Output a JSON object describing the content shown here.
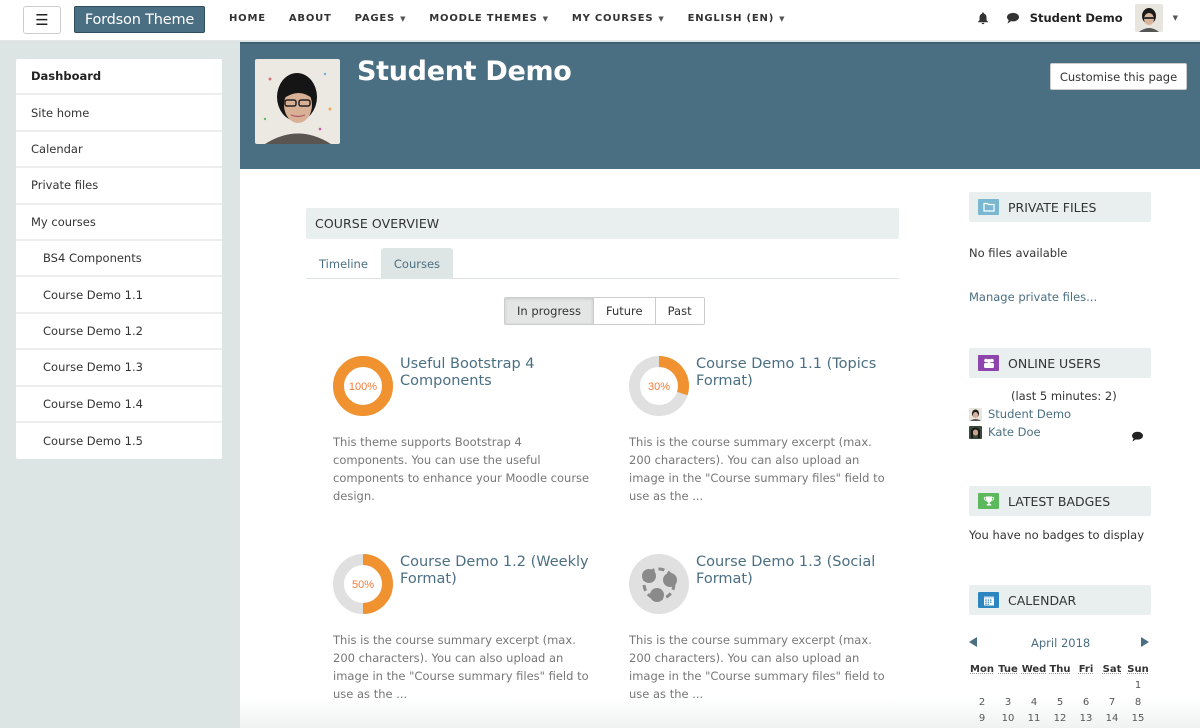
{
  "navbar": {
    "menu_icon": "hamburger-icon",
    "brand": "Fordson Theme",
    "links": [
      {
        "label": "HOME",
        "dropdown": false
      },
      {
        "label": "ABOUT",
        "dropdown": false
      },
      {
        "label": "PAGES",
        "dropdown": true
      },
      {
        "label": "MOODLE THEMES",
        "dropdown": true
      },
      {
        "label": "MY COURSES",
        "dropdown": true
      },
      {
        "label": "ENGLISH (EN)",
        "dropdown": true
      }
    ],
    "notification_icon": "bell-icon",
    "message_icon": "chat-bubble-icon",
    "user_name": "Student Demo",
    "caret": "▾"
  },
  "sidebar": {
    "items": [
      {
        "label": "Dashboard"
      },
      {
        "label": "Site home"
      },
      {
        "label": "Calendar"
      },
      {
        "label": "Private files"
      },
      {
        "label": "My courses"
      },
      {
        "label": "BS4 Components"
      },
      {
        "label": "Course Demo 1.1"
      },
      {
        "label": "Course Demo 1.2"
      },
      {
        "label": "Course Demo 1.3"
      },
      {
        "label": "Course Demo 1.4"
      },
      {
        "label": "Course Demo 1.5"
      }
    ]
  },
  "header": {
    "title": "Student Demo",
    "customise_button": "Customise this page"
  },
  "course_overview": {
    "title": "COURSE OVERVIEW",
    "tabs": [
      {
        "label": "Timeline",
        "active": false
      },
      {
        "label": "Courses",
        "active": true
      }
    ],
    "filters": [
      {
        "label": "In progress",
        "active": true
      },
      {
        "label": "Future",
        "active": false
      },
      {
        "label": "Past",
        "active": false
      }
    ],
    "courses": [
      {
        "title": "Useful Bootstrap 4 Components",
        "progress": 100,
        "progress_label": "100%",
        "summary": "This theme supports Bootstrap 4 components. You can use the useful components to enhance your Moodle course design."
      },
      {
        "title": "Course Demo 1.1 (Topics Format)",
        "progress": 30,
        "progress_label": "30%",
        "summary": "This is the course summary excerpt (max. 200 characters). You can also upload an image in the \"Course summary files\" field to use as the ..."
      },
      {
        "title": "Course Demo 1.2 (Weekly Format)",
        "progress": 50,
        "progress_label": "50%",
        "summary": "This is the course summary excerpt (max. 200 characters). You can also upload an image in the \"Course summary files\" field to use as the ..."
      },
      {
        "title": "Course Demo 1.3 (Social Format)",
        "progress": null,
        "progress_label": "",
        "icon": "social-course-icon",
        "summary": "This is the course summary excerpt (max. 200 characters). You can also upload an image in the \"Course summary files\" field to use as the ..."
      }
    ]
  },
  "blocks": {
    "private_files": {
      "title": "PRIVATE FILES",
      "icon": "folder-icon",
      "empty_text": "No files available",
      "manage_link": "Manage private files..."
    },
    "online_users": {
      "title": "ONLINE USERS",
      "icon": "users-icon",
      "subtitle": "(last 5 minutes: 2)",
      "users": [
        {
          "name": "Student Demo"
        },
        {
          "name": "Kate Doe"
        }
      ]
    },
    "latest_badges": {
      "title": "LATEST BADGES",
      "icon": "trophy-icon",
      "empty_text": "You have no badges to display"
    },
    "calendar": {
      "title": "CALENDAR",
      "icon": "calendar-icon",
      "month": "April 2018",
      "weekdays": [
        "Mon",
        "Tue",
        "Wed",
        "Thu",
        "Fri",
        "Sat",
        "Sun"
      ],
      "weeks": [
        [
          "",
          "",
          "",
          "",
          "",
          "",
          "1"
        ],
        [
          "2",
          "3",
          "4",
          "5",
          "6",
          "7",
          "8"
        ],
        [
          "9",
          "10",
          "11",
          "12",
          "13",
          "14",
          "15"
        ]
      ]
    }
  },
  "colors": {
    "brand": "#4a6e82",
    "accent_orange": "#f0922f",
    "progress_track": "#e0e0e0",
    "link": "#4b6f82",
    "folder_icon_bg": "#7ab8d2",
    "users_icon_bg": "#8e44ad",
    "badge_icon_bg": "#5cb85c",
    "calendar_icon_bg": "#2e86c1"
  }
}
